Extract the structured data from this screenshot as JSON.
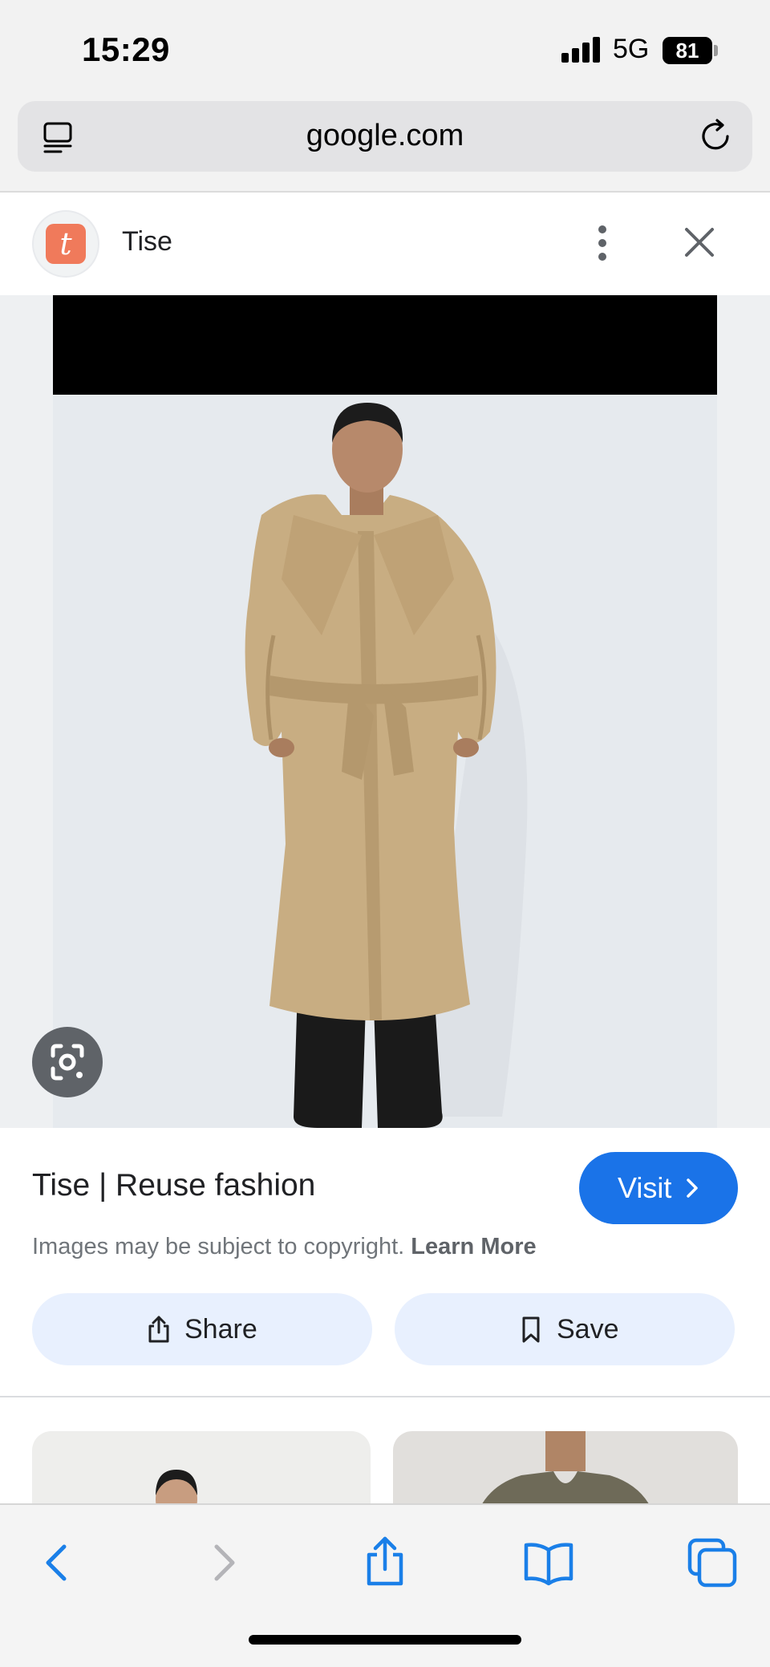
{
  "status_bar": {
    "time": "15:29",
    "network": "5G",
    "battery": "81"
  },
  "browser": {
    "url": "google.com"
  },
  "source": {
    "site_name": "Tise",
    "logo_letter": "t",
    "logo_color": "#f07a5b"
  },
  "result": {
    "title": "Tise | Reuse fashion",
    "visit_label": "Visit",
    "copyright_text": "Images may be subject to copyright.",
    "learn_more": "Learn More",
    "share_label": "Share",
    "save_label": "Save"
  },
  "colors": {
    "accent": "#1a73e8",
    "chip_bg": "#e8f0fe",
    "coat": "#c8ad82",
    "safari_blue": "#1a7fe8"
  },
  "icons": [
    "tabs-icon",
    "reload-icon",
    "more-vert-icon",
    "close-icon",
    "google-lens-icon",
    "chevron-right-icon",
    "share-icon",
    "bookmark-icon",
    "back-icon",
    "forward-icon",
    "bookmarks-icon",
    "tabs-overview-icon"
  ]
}
